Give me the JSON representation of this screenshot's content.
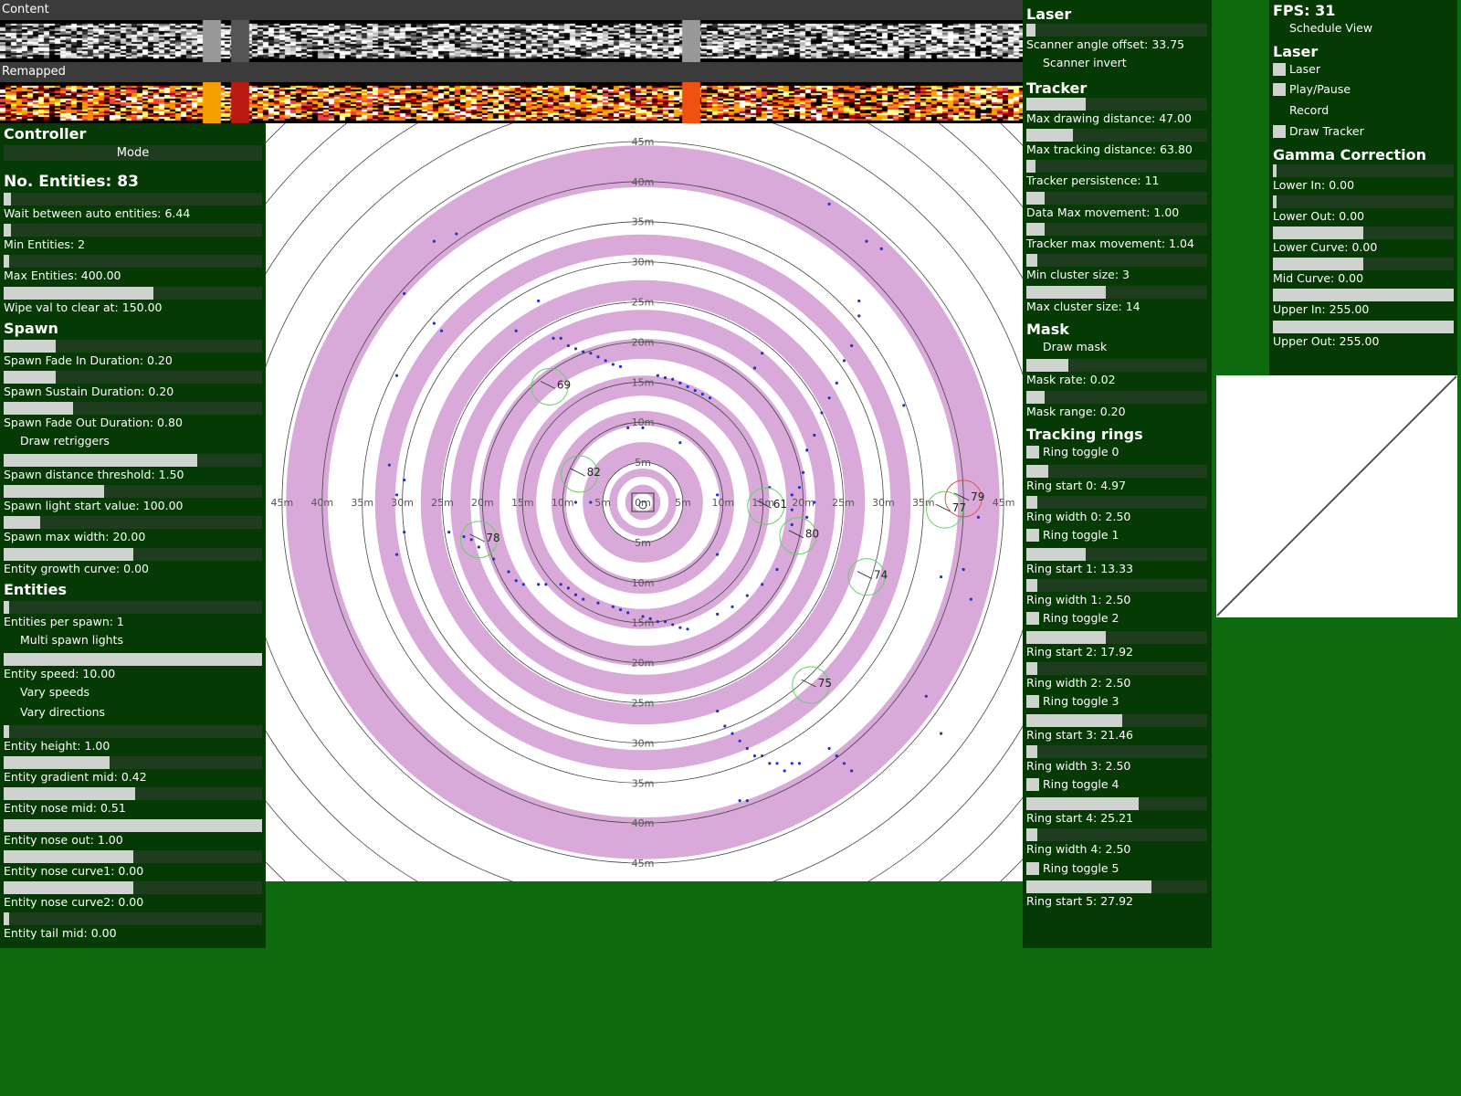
{
  "strips": {
    "content_label": "Content",
    "remapped_label": "Remapped"
  },
  "controller": {
    "title": "Controller",
    "mode_button": "Mode",
    "entities_count": "No. Entities: 83",
    "items": [
      {
        "type": "slider",
        "label": "Wait between auto entities: 6.44",
        "value": 0.03
      },
      {
        "type": "slider",
        "label": "Min Entities: 2",
        "value": 0.03
      },
      {
        "type": "slider",
        "label": "Max Entities: 400.00",
        "value": 0.0
      },
      {
        "type": "slider",
        "label": "Wipe val to clear at: 150.00",
        "value": 0.58
      },
      {
        "type": "header",
        "label": "Spawn"
      },
      {
        "type": "slider",
        "label": "Spawn Fade In Duration: 0.20",
        "value": 0.2
      },
      {
        "type": "slider",
        "label": "Spawn Sustain Duration: 0.20",
        "value": 0.2
      },
      {
        "type": "slider",
        "label": "Spawn Fade Out Duration: 0.80",
        "value": 0.27
      },
      {
        "type": "checkbox",
        "label": "Draw retriggers",
        "checked": false
      },
      {
        "type": "slider",
        "label": "Spawn distance threshold: 1.50",
        "value": 0.75
      },
      {
        "type": "slider",
        "label": "Spawn light start value: 100.00",
        "value": 0.39
      },
      {
        "type": "slider",
        "label": "Spawn max width: 20.00",
        "value": 0.14
      },
      {
        "type": "slider",
        "label": "Entity growth curve: 0.00",
        "value": 0.5
      },
      {
        "type": "header",
        "label": "Entities"
      },
      {
        "type": "slider",
        "label": "Entities per spawn: 1",
        "value": 0.0
      },
      {
        "type": "checkbox",
        "label": "Multi spawn lights",
        "checked": false
      },
      {
        "type": "slider",
        "label": "Entity speed: 10.00",
        "value": 1.0
      },
      {
        "type": "checkbox",
        "label": "Vary speeds",
        "checked": false
      },
      {
        "type": "checkbox",
        "label": "Vary directions",
        "checked": false
      },
      {
        "type": "slider",
        "label": "Entity height: 1.00",
        "value": 0.0
      },
      {
        "type": "slider",
        "label": "Entity gradient mid: 0.42",
        "value": 0.41
      },
      {
        "type": "slider",
        "label": "Entity nose mid: 0.51",
        "value": 0.51
      },
      {
        "type": "slider",
        "label": "Entity nose out: 1.00",
        "value": 1.0
      },
      {
        "type": "slider",
        "label": "Entity nose curve1: 0.00",
        "value": 0.5
      },
      {
        "type": "slider",
        "label": "Entity nose curve2: 0.00",
        "value": 0.5
      },
      {
        "type": "slider",
        "label": "Entity tail mid: 0.00",
        "value": 0.0
      }
    ]
  },
  "right_panel": {
    "items": [
      {
        "type": "header",
        "label": "Laser"
      },
      {
        "type": "slider",
        "label": "Scanner angle offset: 33.75",
        "value": 0.05
      },
      {
        "type": "checkbox",
        "label": "Scanner invert",
        "checked": false
      },
      {
        "type": "header",
        "label": "Tracker"
      },
      {
        "type": "slider",
        "label": "Max drawing distance: 47.00",
        "value": 0.33
      },
      {
        "type": "slider",
        "label": "Max tracking distance: 63.80",
        "value": 0.26
      },
      {
        "type": "slider",
        "label": "Tracker persistence: 11",
        "value": 0.05
      },
      {
        "type": "slider",
        "label": "Data Max movement: 1.00",
        "value": 0.1
      },
      {
        "type": "slider",
        "label": "Tracker max movement: 1.04",
        "value": 0.1
      },
      {
        "type": "slider",
        "label": "Min cluster size: 3",
        "value": 0.06
      },
      {
        "type": "slider",
        "label": "Max cluster size: 14",
        "value": 0.44
      },
      {
        "type": "header",
        "label": "Mask"
      },
      {
        "type": "checkbox",
        "label": "Draw mask",
        "checked": false
      },
      {
        "type": "slider",
        "label": "Mask rate: 0.02",
        "value": 0.23
      },
      {
        "type": "slider",
        "label": "Mask range: 0.20",
        "value": 0.1
      },
      {
        "type": "header",
        "label": "Tracking rings"
      },
      {
        "type": "checkbox",
        "label": "Ring toggle 0",
        "checked": true
      },
      {
        "type": "slider",
        "label": "Ring start 0: 4.97",
        "value": 0.12
      },
      {
        "type": "slider",
        "label": "Ring width 0: 2.50",
        "value": 0.06
      },
      {
        "type": "checkbox",
        "label": "Ring toggle 1",
        "checked": true
      },
      {
        "type": "slider",
        "label": "Ring start 1: 13.33",
        "value": 0.33
      },
      {
        "type": "slider",
        "label": "Ring width 1: 2.50",
        "value": 0.06
      },
      {
        "type": "checkbox",
        "label": "Ring toggle 2",
        "checked": true
      },
      {
        "type": "slider",
        "label": "Ring start 2: 17.92",
        "value": 0.44
      },
      {
        "type": "slider",
        "label": "Ring width 2: 2.50",
        "value": 0.06
      },
      {
        "type": "checkbox",
        "label": "Ring toggle 3",
        "checked": true
      },
      {
        "type": "slider",
        "label": "Ring start 3: 21.46",
        "value": 0.53
      },
      {
        "type": "slider",
        "label": "Ring width 3: 2.50",
        "value": 0.06
      },
      {
        "type": "checkbox",
        "label": "Ring toggle 4",
        "checked": true
      },
      {
        "type": "slider",
        "label": "Ring start 4: 25.21",
        "value": 0.62
      },
      {
        "type": "slider",
        "label": "Ring width 4: 2.50",
        "value": 0.06
      },
      {
        "type": "checkbox",
        "label": "Ring toggle 5",
        "checked": true
      },
      {
        "type": "slider",
        "label": "Ring start 5: 27.92",
        "value": 0.69
      }
    ]
  },
  "far_right": {
    "fps": "FPS: 31",
    "items": [
      {
        "type": "checkbox",
        "label": "Schedule View",
        "checked": false
      },
      {
        "type": "header",
        "label": "Laser"
      },
      {
        "type": "checkbox",
        "label": "Laser",
        "checked": true
      },
      {
        "type": "checkbox",
        "label": "Play/Pause",
        "checked": true
      },
      {
        "type": "checkbox",
        "label": "Record",
        "checked": false
      },
      {
        "type": "checkbox",
        "label": "Draw Tracker",
        "checked": true
      },
      {
        "type": "header",
        "label": "Gamma Correction"
      },
      {
        "type": "slider",
        "label": "Lower In: 0.00",
        "value": 0.0
      },
      {
        "type": "slider",
        "label": "Lower Out: 0.00",
        "value": 0.0
      },
      {
        "type": "slider",
        "label": "Lower Curve: 0.00",
        "value": 0.5
      },
      {
        "type": "slider",
        "label": "Mid Curve: 0.00",
        "value": 0.5
      },
      {
        "type": "slider",
        "label": "Upper In: 255.00",
        "value": 1.0
      },
      {
        "type": "slider",
        "label": "Upper Out: 255.00",
        "value": 1.0
      }
    ]
  },
  "radar": {
    "ring_color": "#d9aad9",
    "axis_labels_top": [
      "45m",
      "40m",
      "35m",
      "30m",
      "25m",
      "20m",
      "15m",
      "10m",
      "5m"
    ],
    "axis_labels_h": [
      "45m",
      "40m",
      "35m",
      "30m",
      "25m",
      "20m",
      "15m",
      "10m",
      "5m",
      "0m",
      "5m",
      "10m",
      "15m",
      "20m",
      "25m",
      "30m",
      "35m",
      "45m"
    ],
    "axis_labels_bottom": [
      "5m",
      "10m",
      "15m",
      "20m",
      "25m",
      "30m",
      "35m",
      "40m",
      "45m"
    ],
    "trackers": [
      {
        "id": "69",
        "color": "#5fd35f"
      },
      {
        "id": "82",
        "color": "#5fd35f"
      },
      {
        "id": "78",
        "color": "#5fd35f"
      },
      {
        "id": "61",
        "color": "#5fd35f"
      },
      {
        "id": "80",
        "color": "#5fd35f"
      },
      {
        "id": "77",
        "color": "#5fd35f"
      },
      {
        "id": "79",
        "color": "#e05050"
      },
      {
        "id": "74",
        "color": "#5fd35f"
      },
      {
        "id": "75",
        "color": "#5fd35f"
      }
    ]
  }
}
